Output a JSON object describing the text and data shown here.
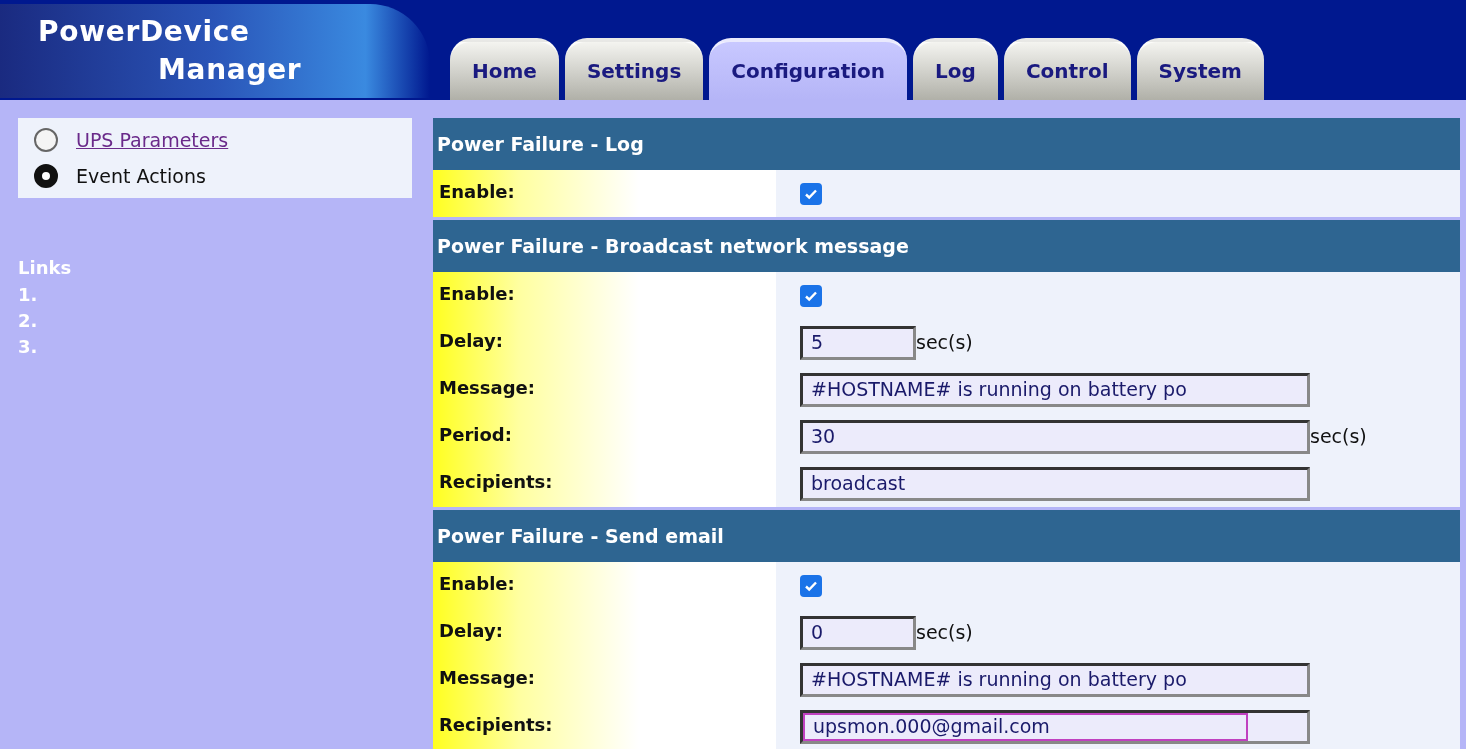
{
  "logo": {
    "lines": [
      "PowerDevice",
      "Manager"
    ]
  },
  "tabs": [
    {
      "label": "Home",
      "selected": false
    },
    {
      "label": "Settings",
      "selected": false
    },
    {
      "label": "Configuration",
      "selected": true
    },
    {
      "label": "Log",
      "selected": false
    },
    {
      "label": "Control",
      "selected": false
    },
    {
      "label": "System",
      "selected": false
    }
  ],
  "sidebar": {
    "items": [
      {
        "label": "UPS Parameters",
        "selected": false
      },
      {
        "label": "Event Actions",
        "selected": true
      }
    ],
    "links_title": "Links",
    "links": [
      "1.",
      "2.",
      "3."
    ]
  },
  "sections": [
    {
      "title": "Power Failure - Log",
      "rows": [
        {
          "kind": "checkbox",
          "label": "Enable:",
          "checked": true
        }
      ]
    },
    {
      "title": "Power Failure - Broadcast network message",
      "rows": [
        {
          "kind": "checkbox",
          "label": "Enable:",
          "checked": true
        },
        {
          "kind": "short",
          "label": "Delay:",
          "value": "5",
          "unit": "sec(s)",
          "focused": false
        },
        {
          "kind": "long",
          "label": "Message:",
          "value": "#HOSTNAME# is running on battery po",
          "focused": false
        },
        {
          "kind": "long",
          "label": "Period:",
          "value": "30",
          "unit": "sec(s)",
          "focused": false
        },
        {
          "kind": "long",
          "label": "Recipients:",
          "value": "broadcast",
          "focused": false
        }
      ]
    },
    {
      "title": "Power Failure - Send email",
      "rows": [
        {
          "kind": "checkbox",
          "label": "Enable:",
          "checked": true
        },
        {
          "kind": "short",
          "label": "Delay:",
          "value": "0",
          "unit": "sec(s)",
          "focused": false
        },
        {
          "kind": "long",
          "label": "Message:",
          "value": "#HOSTNAME# is running on battery po",
          "focused": false
        },
        {
          "kind": "long",
          "label": "Recipients:",
          "value": "upsmon.000@gmail.com",
          "focused": true
        }
      ]
    }
  ]
}
